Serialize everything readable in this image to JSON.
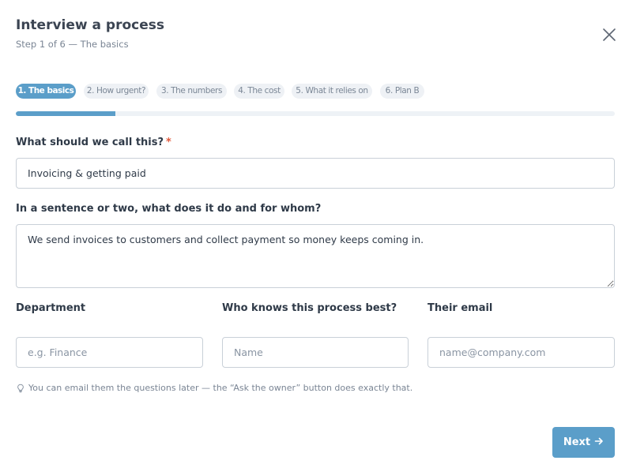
{
  "dialog": {
    "title": "Interview a process",
    "subtitle": "Step 1 of 6 — The basics",
    "close_icon": "close-icon"
  },
  "steps": {
    "items": [
      {
        "label": "1. The basics",
        "active": true
      },
      {
        "label": "2. How urgent?",
        "active": false
      },
      {
        "label": "3. The numbers",
        "active": false
      },
      {
        "label": "4. The cost",
        "active": false
      },
      {
        "label": "5. What it relies on",
        "active": false
      },
      {
        "label": "6. Plan B",
        "active": false
      }
    ],
    "progress": 0.1667,
    "accent_color": "#5b9ec9"
  },
  "form": {
    "name": {
      "label": "What should we call this?",
      "required_mark": "*",
      "value": "Invoicing & getting paid"
    },
    "description": {
      "label": "In a sentence or two, what does it do and for whom?",
      "value": "We send invoices to customers and collect payment so money keeps coming in."
    },
    "department": {
      "label": "Department",
      "value": "",
      "placeholder": "e.g. Finance"
    },
    "owner": {
      "label": "Who knows this process best?",
      "value": "",
      "placeholder": "Name"
    },
    "email": {
      "label": "Their email",
      "value": "",
      "placeholder": "name@company.com"
    }
  },
  "hint": {
    "icon": "lightbulb-icon",
    "text": "You can email them the questions later — the “Ask the owner” button does exactly that."
  },
  "footer": {
    "next_label": "Next",
    "next_icon": "arrow-right-icon"
  }
}
